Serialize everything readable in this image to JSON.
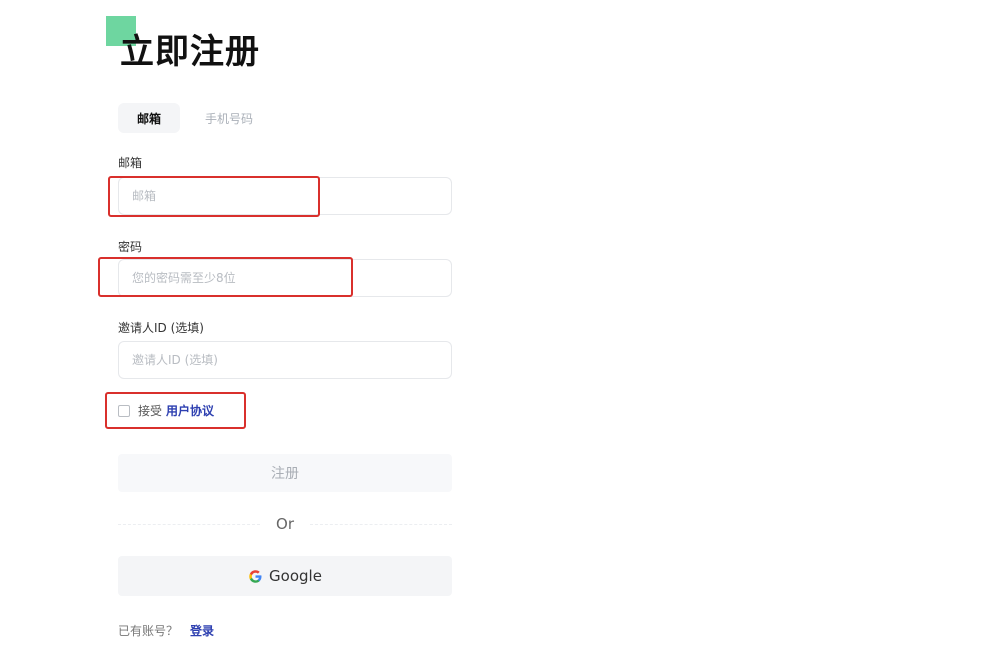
{
  "page": {
    "title": "立即注册"
  },
  "tabs": [
    {
      "label": "邮箱",
      "active": true
    },
    {
      "label": "手机号码",
      "active": false
    }
  ],
  "form": {
    "email": {
      "label": "邮箱",
      "placeholder": "邮箱",
      "value": ""
    },
    "password": {
      "label": "密码",
      "placeholder": "您的密码需至少8位",
      "value": ""
    },
    "referrer": {
      "label": "邀请人ID (选填)",
      "placeholder": "邀请人ID (选填)",
      "value": ""
    },
    "agree": {
      "prefix": "接受",
      "link": "用户协议",
      "checked": false
    },
    "register_label": "注册",
    "or_label": "Or",
    "google_label": "Google"
  },
  "footer": {
    "question": "已有账号？",
    "login_label": "登录"
  },
  "colors": {
    "accent": "#2d3fb0",
    "highlight": "#d9302c",
    "logo": "#6ed6a0"
  }
}
